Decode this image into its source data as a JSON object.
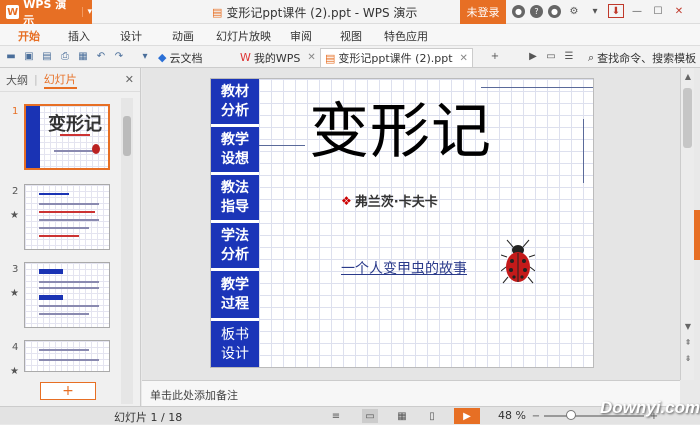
{
  "app": {
    "name": "WPS 演示",
    "doc_title": "变形记ppt课件 (2).ppt - WPS 演示",
    "login": "未登录"
  },
  "menu": [
    "开始",
    "插入",
    "设计",
    "动画",
    "幻灯片放映",
    "审阅",
    "视图",
    "特色应用"
  ],
  "tabs": {
    "cloud": "云文档",
    "mywps": "我的WPS",
    "doc": "变形记ppt课件 (2).ppt",
    "search": "查找命令、搜索模板"
  },
  "sidebar": {
    "outline": "大纲",
    "slides": "幻灯片",
    "numbers": [
      "1",
      "2",
      "3",
      "4"
    ]
  },
  "thumb1": {
    "title": "变形记"
  },
  "slide": {
    "nav": [
      {
        "l1": "教材",
        "l2": "分析"
      },
      {
        "l1": "教学",
        "l2": "设想"
      },
      {
        "l1": "教法",
        "l2": "指导"
      },
      {
        "l1": "学法",
        "l2": "分析"
      },
      {
        "l1": "教学",
        "l2": "过程"
      },
      {
        "l1": "板书",
        "l2": "设计"
      }
    ],
    "title": "变形记",
    "author": "弗兰茨·卡夫卡",
    "subtitle": "一个人变甲虫的故事"
  },
  "notes": {
    "placeholder": "单击此处添加备注"
  },
  "status": {
    "slide": "幻灯片 1 / 18",
    "zoom": "48 %"
  },
  "watermark": "Downyi.com",
  "colors": {
    "accent": "#e76f24",
    "nav_blue": "#1b35b8"
  }
}
